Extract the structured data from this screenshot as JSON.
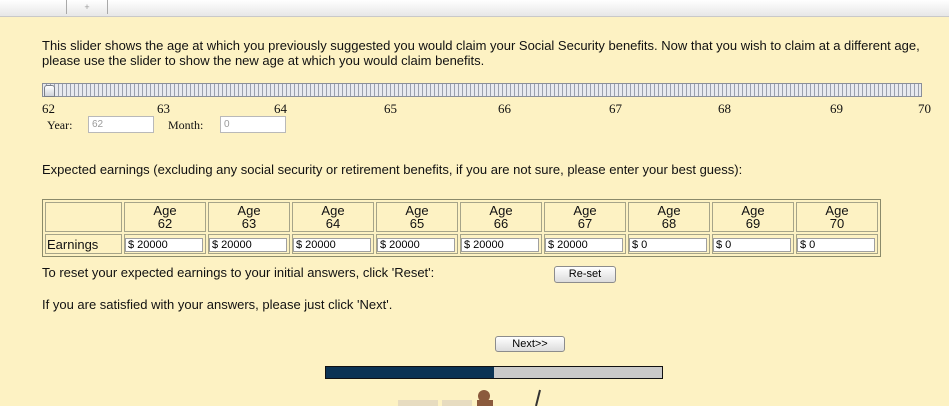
{
  "intro_text": "This slider shows the age at which you previously suggested you would claim your Social Security benefits. Now that you wish to claim at a different age, please use the slider to show the new age at which you would claim benefits.",
  "slider": {
    "ticks": [
      "62",
      "63",
      "64",
      "65",
      "66",
      "67",
      "68",
      "69",
      "70"
    ],
    "value": 62,
    "min": 62,
    "max": 70
  },
  "year": {
    "label": "Year:",
    "value": "62"
  },
  "month": {
    "label": "Month:",
    "value": "0"
  },
  "expected_text": "Expected earnings (excluding any social security or retirement benefits, if you are not sure, please enter your best guess):",
  "table": {
    "age_word": "Age",
    "ages": [
      "62",
      "63",
      "64",
      "65",
      "66",
      "67",
      "68",
      "69",
      "70"
    ],
    "row_label": "Earnings",
    "values": [
      "$ 20000",
      "$ 20000",
      "$ 20000",
      "$ 20000",
      "$ 20000",
      "$ 20000",
      "$ 0",
      "$ 0",
      "$ 0"
    ]
  },
  "reset_text": "To reset your expected earnings to your initial answers, click 'Reset':",
  "reset_button": "Re-set",
  "satisfied_text": "If you are satisfied with your answers, please just click 'Next'.",
  "next_button": "Next>>",
  "progress": {
    "fraction": 0.5,
    "fill_color": "#0b3354",
    "empty_color": "#c9c9c9"
  },
  "colors": {
    "background": "#fdf2c3"
  }
}
